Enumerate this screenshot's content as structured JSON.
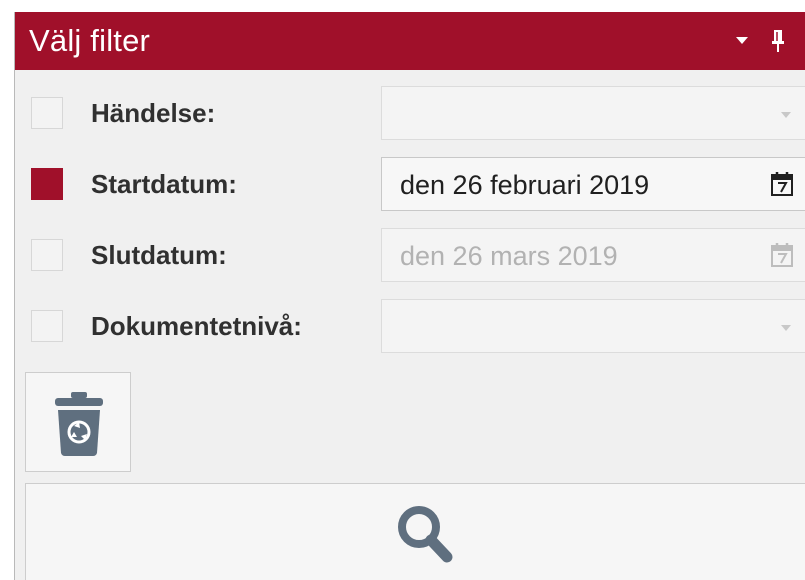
{
  "panel": {
    "title": "Välj filter",
    "accent_color": "#a0102a",
    "title_icons": [
      "dropdown-menu-icon",
      "pin-icon"
    ]
  },
  "filters": [
    {
      "label": "Händelse:",
      "checked": false,
      "type": "dropdown",
      "value": ""
    },
    {
      "label": "Startdatum:",
      "checked": true,
      "type": "date",
      "value": "den 26 februari 2019"
    },
    {
      "label": "Slutdatum:",
      "checked": false,
      "type": "date",
      "value": "den 26 mars 2019"
    },
    {
      "label": "Dokumentetnivå:",
      "checked": false,
      "type": "dropdown",
      "value": ""
    }
  ],
  "actions": {
    "clear_icon": "recycle-trash-icon",
    "search_icon": "search-icon"
  }
}
